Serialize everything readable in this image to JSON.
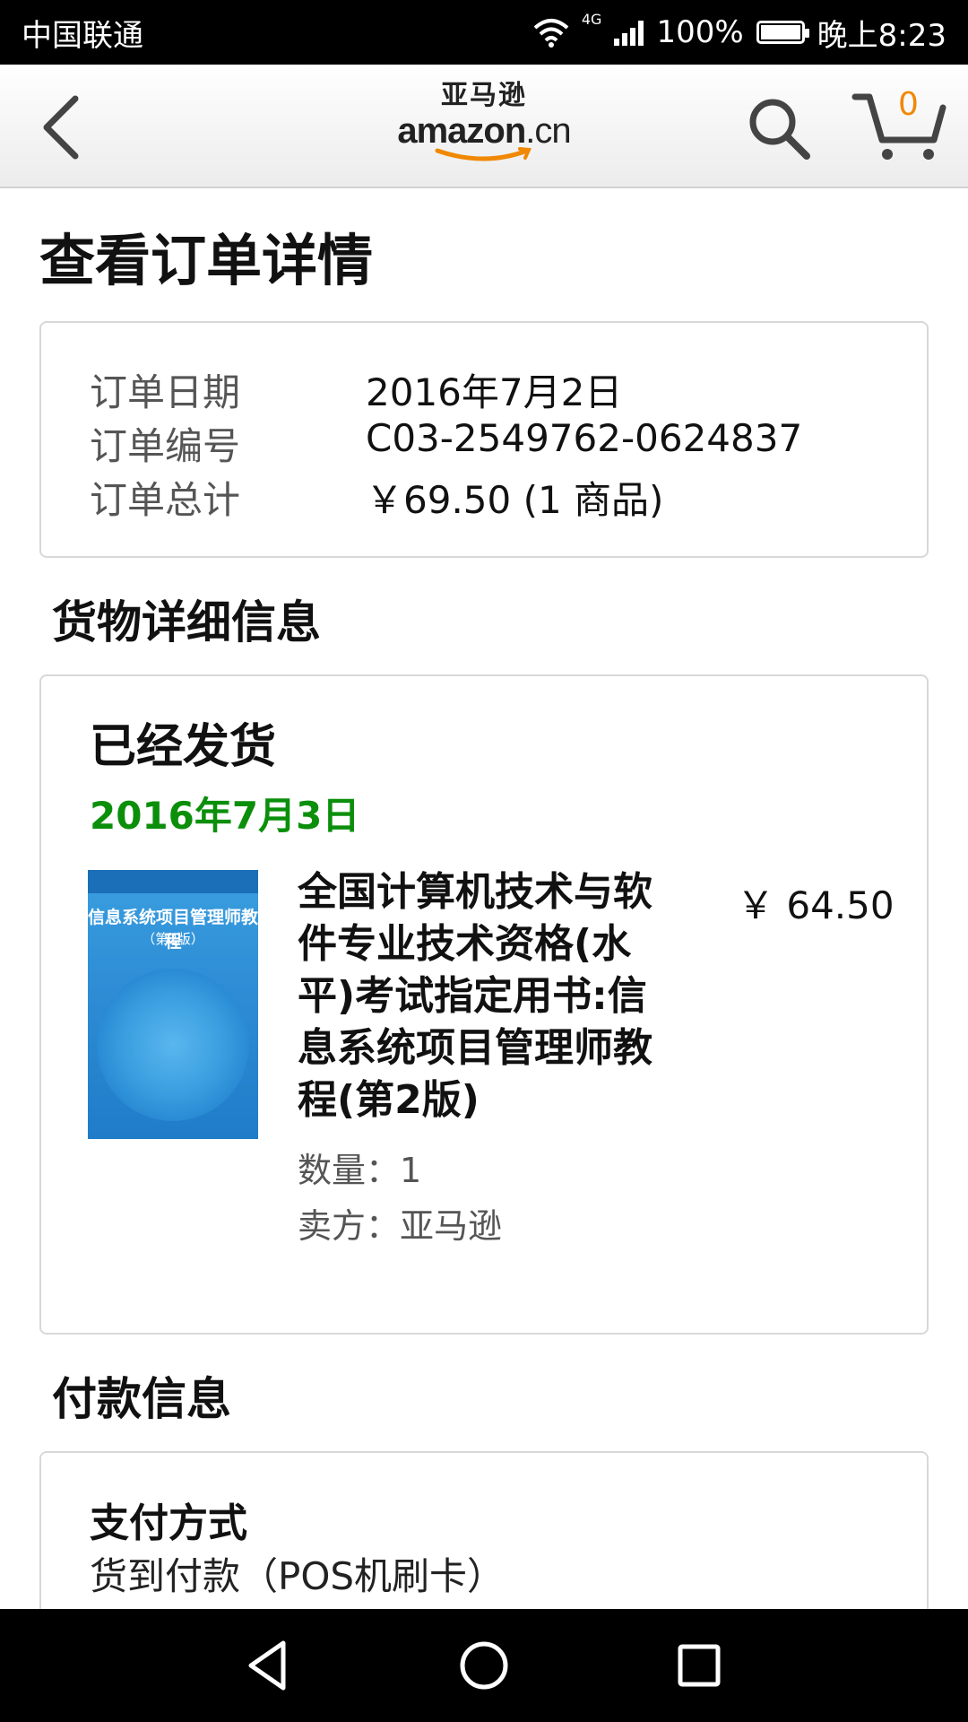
{
  "status_bar": {
    "carrier": "中国联通",
    "network": "4G",
    "battery": "100%",
    "time": "晚上8:23"
  },
  "header": {
    "logo_cn": "亚马逊",
    "logo_en_main": "amazon",
    "logo_en_suffix": ".cn",
    "cart_count": "0"
  },
  "page": {
    "title": "查看订单详情"
  },
  "order_summary": {
    "rows": [
      {
        "label": "订单日期",
        "value": "2016年7月2日"
      },
      {
        "label": "订单编号",
        "value": "C03-2549762-0624837"
      },
      {
        "label": "订单总计",
        "value": "￥69.50 (1 商品)"
      }
    ]
  },
  "shipment": {
    "section_title": "货物详细信息",
    "status": "已经发货",
    "date": "2016年7月3日",
    "item": {
      "title": "全国计算机技术与软件专业技术资格(水平)考试指定用书:信息系统项目管理师教程(第2版)",
      "price": "￥ 64.50",
      "quantity": "数量：1",
      "seller": "卖方：亚马逊",
      "cover_title": "信息系统项目管理师教程",
      "cover_edition": "（第2版）"
    }
  },
  "payment": {
    "section_title": "付款信息",
    "method_label": "支付方式",
    "method_value": "货到付款（POS机刷卡）"
  },
  "colors": {
    "ship_date": "#0b8f0b",
    "cart_count": "#f08804",
    "logo_smile": "#f08804"
  }
}
